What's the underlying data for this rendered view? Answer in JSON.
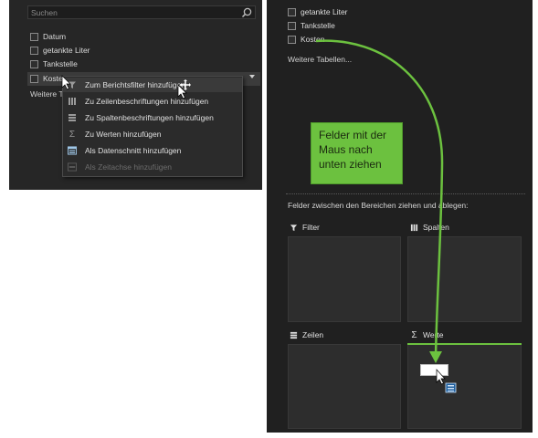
{
  "left": {
    "search": {
      "placeholder": "Suchen",
      "icon": "search-icon"
    },
    "fields": [
      {
        "label": "Datum",
        "checked": false
      },
      {
        "label": "getankte Liter",
        "checked": false
      },
      {
        "label": "Tankstelle",
        "checked": false
      },
      {
        "label": "Kosten",
        "checked": false
      }
    ],
    "more_tables": "Weitere T",
    "context_menu": [
      {
        "label": "Zum Berichtsfilter hinzufügen",
        "icon": "filter-icon",
        "enabled": true
      },
      {
        "label": "Zu Zeilenbeschriftungen hinzufügen",
        "icon": "rows-icon",
        "enabled": true
      },
      {
        "label": "Zu Spaltenbeschriftungen hinzufügen",
        "icon": "columns-icon",
        "enabled": true
      },
      {
        "label": "Zu Werten hinzufügen",
        "icon": "sigma-icon",
        "enabled": true
      },
      {
        "label": "Als Datenschnitt hinzufügen",
        "icon": "slicer-icon",
        "enabled": true
      },
      {
        "label": "Als Zeitachse hinzufügen",
        "icon": "timeline-icon",
        "enabled": false
      }
    ]
  },
  "right": {
    "fields": [
      {
        "label": "getankte Liter"
      },
      {
        "label": "Tankstelle"
      },
      {
        "label": "Kosten"
      }
    ],
    "more_tables": "Weitere Tabellen...",
    "areas_hint": "Felder zwischen den Bereichen ziehen und ablegen:",
    "areas": {
      "filter": "Filter",
      "spalten": "Spalten",
      "zeilen": "Zeilen",
      "werte": "Werte"
    },
    "callout": "Felder mit der Maus nach unten ziehen"
  },
  "colors": {
    "accent": "#6cc13f",
    "panel_bg": "#262626",
    "area_bg": "#2d2d2d"
  }
}
